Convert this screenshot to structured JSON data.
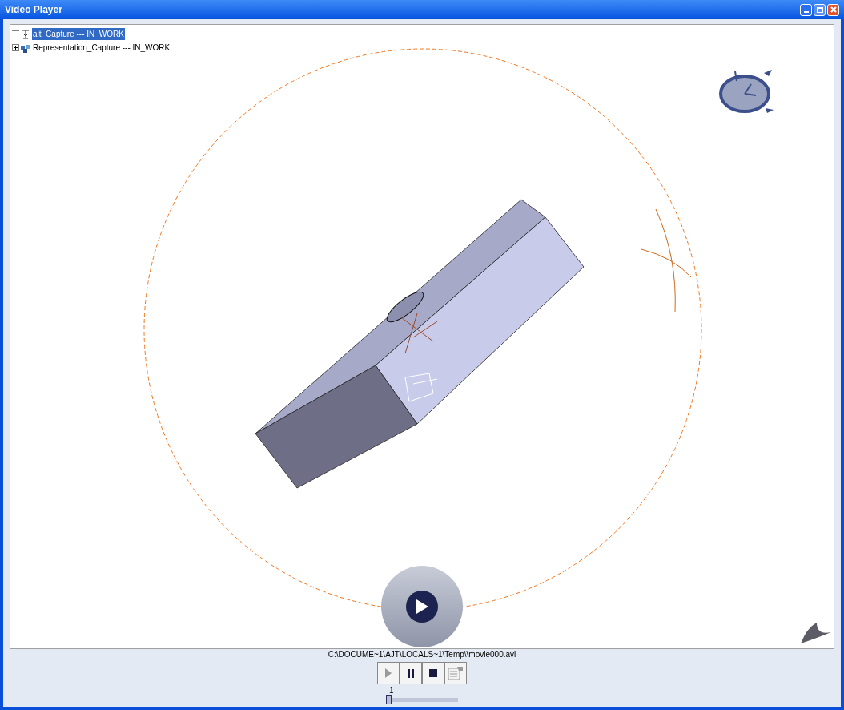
{
  "window": {
    "title": "Video Player"
  },
  "tree": [
    {
      "label": "ajt_Capture --- IN_WORK",
      "selected": true,
      "expanded": true
    },
    {
      "label": "Representation_Capture --- IN_WORK",
      "selected": false,
      "expanded": false
    }
  ],
  "file_path": "C:\\DOCUME~1\\AJT\\LOCALS~1\\Temp\\\\movie000.avi",
  "controls": [
    {
      "kind": "play",
      "disabled": true
    },
    {
      "kind": "pause",
      "disabled": false
    },
    {
      "kind": "stop",
      "disabled": false
    },
    {
      "kind": "properties",
      "disabled": true
    }
  ],
  "frame_slider": {
    "reading": "1",
    "level": 0
  }
}
